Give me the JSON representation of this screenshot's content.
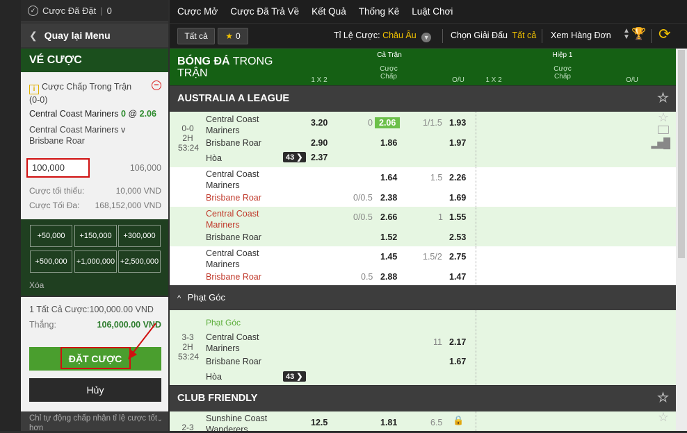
{
  "left": {
    "bets_placed_label": "Cược Đã Đặt",
    "bets_placed_count": "0",
    "back_label": "Quay lại Menu",
    "slip_title": "VÉ CƯỢC",
    "bet_type": "Cược Chấp Trong Trận",
    "bet_score": "(0-0)",
    "selection_team": "Central Coast Mariners",
    "selection_hdp": "0",
    "selection_at": "@",
    "selection_odds": "2.06",
    "match_line1": "Central Coast Mariners v",
    "match_line2": "Brisbane Roar",
    "stake_value": "100,000",
    "payout_value": "106,000",
    "min_label": "Cược tối thiểu:",
    "min_value": "10,000 VND",
    "max_label": "Cược Tối Đa:",
    "max_value": "168,152,000 VND",
    "quick_amounts": [
      "+50,000",
      "+150,000",
      "+300,000",
      "+500,000",
      "+1,000,000",
      "+2,500,000"
    ],
    "clear_label": "Xóa",
    "total_label": "1 Tất Cả Cược:",
    "total_value": "100,000.00",
    "currency": "VND",
    "win_label": "Thắng:",
    "win_value": "106,000.00",
    "place_button": "ĐẶT CƯỢC",
    "cancel_button": "Hủy",
    "auto_accept": "Chỉ tự động chấp nhận tỉ lệ cược tốt hơn"
  },
  "nav": {
    "items": [
      "Cược Mở",
      "Cược Đã Trả Về",
      "Kết Quả",
      "Thống Kê",
      "Luật Chơi"
    ]
  },
  "toolbar": {
    "all_label": "Tất cả",
    "fav_count": "0",
    "odds_type_label": "Tỉ Lệ Cược:",
    "odds_type_value": "Châu Âu",
    "league_label": "Chọn Giải Đấu",
    "league_value": "Tất cả",
    "view_label": "Xem Hàng Đơn"
  },
  "header": {
    "title_bold": "BÓNG ĐÁ",
    "title_rest": "TRONG",
    "title_line2": "TRẬN",
    "fulltime": "Cả Trận",
    "half1": "Hiệp 1",
    "col_1x2": "1 X 2",
    "col_hdp_1": "Cược",
    "col_hdp_2": "Chấp",
    "col_ou": "O/U"
  },
  "league1": "AUSTRALIA A LEAGUE",
  "match1": {
    "score": "0-0",
    "period": "2H",
    "clock": "53:24",
    "home": [
      "Central Coast",
      "Mariners"
    ],
    "away": "Brisbane Roar",
    "draw": "Hòa",
    "more": "43",
    "odds_1": "3.20",
    "odds_2": "2.90",
    "odds_x": "2.37",
    "hdp_line": "0",
    "hdp_home": "2.06",
    "hdp_away": "1.86",
    "ou_line": "1/1.5",
    "ou_over": "1.93",
    "ou_under": "1.97"
  },
  "sub_rows": [
    {
      "home": [
        "Central Coast",
        "Mariners"
      ],
      "away": "Brisbane Roar",
      "home_red": false,
      "away_red": true,
      "hdp_home_line": "",
      "hdp_away_line": "0/0.5",
      "hdp_home": "1.64",
      "hdp_away": "2.38",
      "ou_line": "1.5",
      "ou_over": "2.26",
      "ou_under": "1.69"
    },
    {
      "home": [
        "Central Coast",
        "Mariners"
      ],
      "away": "Brisbane Roar",
      "home_red": true,
      "away_red": false,
      "hdp_home_line": "0/0.5",
      "hdp_away_line": "",
      "hdp_home": "2.66",
      "hdp_away": "1.52",
      "ou_line": "1",
      "ou_over": "1.55",
      "ou_under": "2.53"
    },
    {
      "home": [
        "Central Coast",
        "Mariners"
      ],
      "away": "Brisbane Roar",
      "home_red": false,
      "away_red": true,
      "hdp_home_line": "",
      "hdp_away_line": "0.5",
      "hdp_home": "1.45",
      "hdp_away": "2.88",
      "ou_line": "1.5/2",
      "ou_over": "2.75",
      "ou_under": "1.47"
    }
  ],
  "corner_section": "Phạt Góc",
  "corner_match": {
    "tag": "Phạt Góc",
    "score": "3-3",
    "period": "2H",
    "clock": "53:24",
    "home": [
      "Central Coast",
      "Mariners"
    ],
    "away": "Brisbane Roar",
    "draw": "Hòa",
    "more": "43",
    "ou_line": "11",
    "ou_over": "2.17",
    "ou_under": "1.67"
  },
  "league2": "CLUB FRIENDLY",
  "match3": {
    "score": "2-3",
    "home": [
      "Sunshine Coast",
      "Wanderers"
    ],
    "odds_1": "12.5",
    "hdp_home": "1.81",
    "ou_line": "6.5"
  },
  "colors": {
    "brand_green": "#156014",
    "highlight_green": "#6cc04a",
    "annotation_red": "#d01010"
  }
}
